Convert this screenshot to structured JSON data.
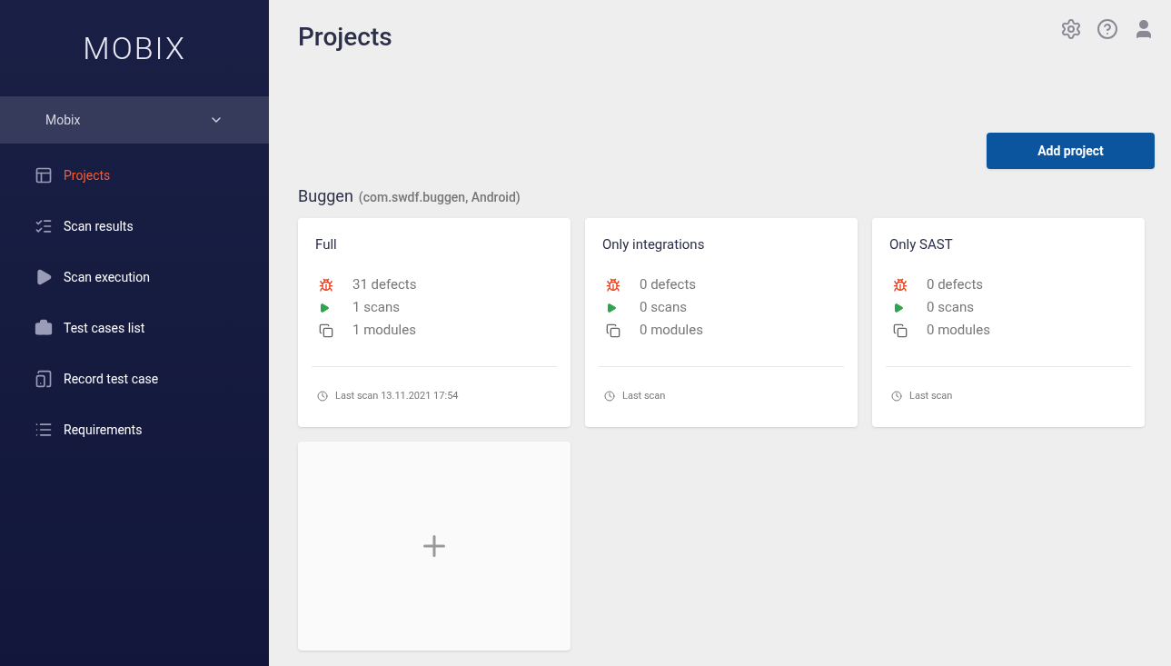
{
  "logo": "MOBIX",
  "workspace": {
    "name": "Mobix"
  },
  "nav": [
    {
      "kind": "projects",
      "label": "Projects",
      "selected": true
    },
    {
      "kind": "results",
      "label": "Scan results",
      "selected": false
    },
    {
      "kind": "execution",
      "label": "Scan execution",
      "selected": false
    },
    {
      "kind": "testcases",
      "label": "Test cases list",
      "selected": false
    },
    {
      "kind": "record",
      "label": "Record test case",
      "selected": false
    },
    {
      "kind": "requirements",
      "label": "Requirements",
      "selected": false
    }
  ],
  "page_title": "Projects",
  "add_button": "Add project",
  "project": {
    "name": "Buggen",
    "meta": "(com.swdf.buggen, Android)"
  },
  "cards": [
    {
      "title": "Full",
      "stats": [
        {
          "kind": "defects",
          "text": "31 defects"
        },
        {
          "kind": "scans",
          "text": "1 scans"
        },
        {
          "kind": "modules",
          "text": "1 modules"
        }
      ],
      "last_scan": "Last scan 13.11.2021 17:54"
    },
    {
      "title": "Only integrations",
      "stats": [
        {
          "kind": "defects",
          "text": "0 defects"
        },
        {
          "kind": "scans",
          "text": "0 scans"
        },
        {
          "kind": "modules",
          "text": "0 modules"
        }
      ],
      "last_scan": "Last scan"
    },
    {
      "title": "Only SAST",
      "stats": [
        {
          "kind": "defects",
          "text": "0 defects"
        },
        {
          "kind": "scans",
          "text": "0 scans"
        },
        {
          "kind": "modules",
          "text": "0 modules"
        }
      ],
      "last_scan": "Last scan"
    }
  ]
}
